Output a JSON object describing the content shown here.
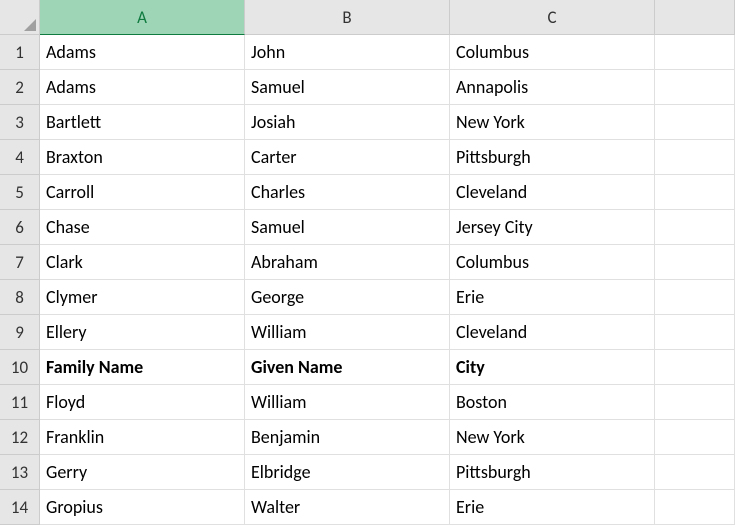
{
  "columns": [
    "A",
    "B",
    "C",
    ""
  ],
  "selected_column_index": 0,
  "rows": [
    {
      "num": "1",
      "cells": [
        "Adams",
        "John",
        "Columbus"
      ],
      "bold": false
    },
    {
      "num": "2",
      "cells": [
        "Adams",
        "Samuel",
        "Annapolis"
      ],
      "bold": false
    },
    {
      "num": "3",
      "cells": [
        "Bartlett",
        "Josiah",
        "New York"
      ],
      "bold": false
    },
    {
      "num": "4",
      "cells": [
        "Braxton",
        "Carter",
        "Pittsburgh"
      ],
      "bold": false
    },
    {
      "num": "5",
      "cells": [
        "Carroll",
        "Charles",
        "Cleveland"
      ],
      "bold": false
    },
    {
      "num": "6",
      "cells": [
        "Chase",
        "Samuel",
        "Jersey City"
      ],
      "bold": false
    },
    {
      "num": "7",
      "cells": [
        "Clark",
        "Abraham",
        "Columbus"
      ],
      "bold": false
    },
    {
      "num": "8",
      "cells": [
        "Clymer",
        "George",
        "Erie"
      ],
      "bold": false
    },
    {
      "num": "9",
      "cells": [
        "Ellery",
        "William",
        "Cleveland"
      ],
      "bold": false
    },
    {
      "num": "10",
      "cells": [
        "Family Name",
        "Given Name",
        "City"
      ],
      "bold": true
    },
    {
      "num": "11",
      "cells": [
        "Floyd",
        "William",
        "Boston"
      ],
      "bold": false
    },
    {
      "num": "12",
      "cells": [
        "Franklin",
        "Benjamin",
        "New York"
      ],
      "bold": false
    },
    {
      "num": "13",
      "cells": [
        "Gerry",
        "Elbridge",
        "Pittsburgh"
      ],
      "bold": false
    },
    {
      "num": "14",
      "cells": [
        "Gropius",
        "Walter",
        "Erie"
      ],
      "bold": false
    }
  ],
  "chart_data": {
    "type": "table",
    "columns": [
      "Family Name",
      "Given Name",
      "City"
    ],
    "rows": [
      [
        "Adams",
        "John",
        "Columbus"
      ],
      [
        "Adams",
        "Samuel",
        "Annapolis"
      ],
      [
        "Bartlett",
        "Josiah",
        "New York"
      ],
      [
        "Braxton",
        "Carter",
        "Pittsburgh"
      ],
      [
        "Carroll",
        "Charles",
        "Cleveland"
      ],
      [
        "Chase",
        "Samuel",
        "Jersey City"
      ],
      [
        "Clark",
        "Abraham",
        "Columbus"
      ],
      [
        "Clymer",
        "George",
        "Erie"
      ],
      [
        "Ellery",
        "William",
        "Cleveland"
      ],
      [
        "Floyd",
        "William",
        "Boston"
      ],
      [
        "Franklin",
        "Benjamin",
        "New York"
      ],
      [
        "Gerry",
        "Elbridge",
        "Pittsburgh"
      ],
      [
        "Gropius",
        "Walter",
        "Erie"
      ]
    ]
  }
}
